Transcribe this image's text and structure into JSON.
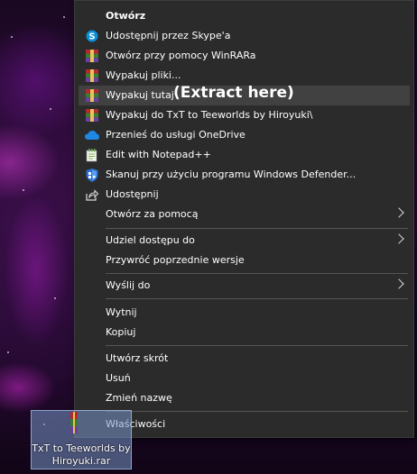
{
  "menu": {
    "items": [
      {
        "label": "Otwórz",
        "icon": "none",
        "bold": true,
        "arrow": false
      },
      {
        "label": "Udostępnij przez Skype'a",
        "icon": "skype-icon",
        "arrow": false
      },
      {
        "label": "Otwórz przy pomocy WinRARa",
        "icon": "winrar-icon",
        "arrow": false
      },
      {
        "label": "Wypakuj pliki...",
        "icon": "winrar-icon",
        "arrow": false
      },
      {
        "label": "Wypakuj tutaj",
        "icon": "winrar-icon",
        "arrow": false,
        "hovered": true
      },
      {
        "label": "Wypakuj do TxT to Teeworlds by Hiroyuki\\",
        "icon": "winrar-icon",
        "arrow": false
      },
      {
        "label": "Przenieś do usługi OneDrive",
        "icon": "onedrive-icon",
        "arrow": false
      },
      {
        "label": "Edit with Notepad++",
        "icon": "notepadpp-icon",
        "arrow": false
      },
      {
        "label": "Skanuj przy użyciu programu Windows Defender...",
        "icon": "defender-icon",
        "arrow": false
      },
      {
        "label": "Udostępnij",
        "icon": "share-icon",
        "arrow": false
      },
      {
        "label": "Otwórz za pomocą",
        "icon": "none",
        "arrow": true
      },
      {
        "label": "Udziel dostępu do",
        "icon": "none",
        "arrow": true
      },
      {
        "label": "Przywróć poprzednie wersje",
        "icon": "none",
        "arrow": false
      },
      {
        "label": "Wyślij do",
        "icon": "none",
        "arrow": true
      },
      {
        "label": "Wytnij",
        "icon": "none",
        "arrow": false
      },
      {
        "label": "Kopiuj",
        "icon": "none",
        "arrow": false
      },
      {
        "label": "Utwórz skrót",
        "icon": "none",
        "arrow": false
      },
      {
        "label": "Usuń",
        "icon": "none",
        "arrow": false
      },
      {
        "label": "Zmień nazwę",
        "icon": "none",
        "arrow": false
      },
      {
        "label": "Właściwości",
        "icon": "none",
        "arrow": false
      }
    ]
  },
  "annotation": "(Extract here)",
  "desktop_file": {
    "name": "TxT to Teeworlds by Hiroyuki.rar",
    "line1": "TxT to Teeworlds by",
    "line2": "Hiroyuki.rar"
  },
  "colors": {
    "menu_bg": "#2b2b2b",
    "hover_bg": "#414141",
    "separator": "#555555",
    "text": "#ffffff"
  }
}
